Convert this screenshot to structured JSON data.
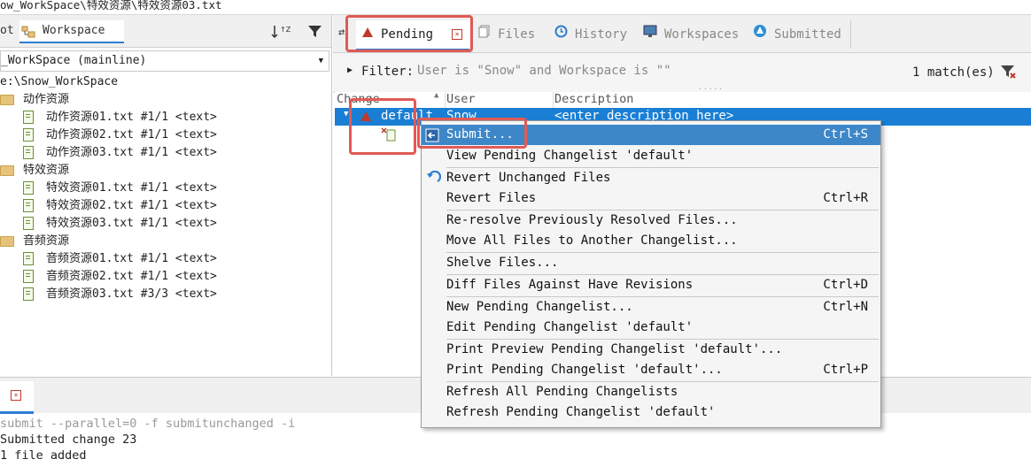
{
  "path_bar": "ow_WorkSpace\\特效资源\\特效资源03.txt",
  "left_tabs": {
    "depot_fragment": "ot",
    "workspace": "Workspace"
  },
  "workspace_selector": "_WorkSpace (mainline)",
  "tree": {
    "root": "e:\\Snow_WorkSpace",
    "folders": [
      {
        "name": "动作资源",
        "files": [
          "动作资源01.txt #1/1 <text>",
          "动作资源02.txt #1/1 <text>",
          "动作资源03.txt #1/1 <text>"
        ]
      },
      {
        "name": "特效资源",
        "files": [
          "特效资源01.txt #1/1 <text>",
          "特效资源02.txt #1/1 <text>",
          "特效资源03.txt #1/1 <text>"
        ]
      },
      {
        "name": "音频资源",
        "files": [
          "音频资源01.txt #1/1 <text>",
          "音频资源02.txt #1/1 <text>",
          "音频资源03.txt #3/3 <text>"
        ]
      }
    ]
  },
  "right_tabs": [
    "Pending",
    "Files",
    "History",
    "Workspaces",
    "Submitted"
  ],
  "filter": {
    "label": "Filter:",
    "text": "User is \"Snow\" and Workspace is \"\"",
    "match_count": "1 match(es)"
  },
  "list_headers": {
    "change": "Change",
    "user": "User",
    "description": "Description"
  },
  "selected_row": {
    "change": "default",
    "user": "Snow",
    "description": "<enter description here>"
  },
  "context_menu": {
    "items": [
      {
        "label": "Submit...",
        "shortcut": "Ctrl+S"
      },
      {
        "label": "View Pending Changelist 'default'",
        "shortcut": ""
      },
      {
        "label": "Revert Unchanged Files",
        "shortcut": ""
      },
      {
        "label": "Revert Files",
        "shortcut": "Ctrl+R"
      },
      {
        "label": "Re-resolve Previously Resolved Files...",
        "shortcut": ""
      },
      {
        "label": "Move All Files to Another Changelist...",
        "shortcut": ""
      },
      {
        "label": "Shelve Files...",
        "shortcut": ""
      },
      {
        "label": "Diff Files Against Have Revisions",
        "shortcut": "Ctrl+D"
      },
      {
        "label": "New Pending Changelist...",
        "shortcut": "Ctrl+N"
      },
      {
        "label": "Edit Pending Changelist 'default'",
        "shortcut": ""
      },
      {
        "label": "Print Preview Pending Changelist 'default'...",
        "shortcut": ""
      },
      {
        "label": "Print Pending Changelist 'default'...",
        "shortcut": "Ctrl+P"
      },
      {
        "label": "Refresh All Pending Changelists",
        "shortcut": ""
      },
      {
        "label": "Refresh Pending Changelist 'default'",
        "shortcut": ""
      }
    ]
  },
  "console": [
    "submit --parallel=0 -f submitunchanged -i",
    "Submitted change 23",
    "1 file added"
  ],
  "colors": {
    "accent": "#1a7fd4",
    "highlight_box": "#e05a55",
    "pending_icon": "#c0392b"
  }
}
